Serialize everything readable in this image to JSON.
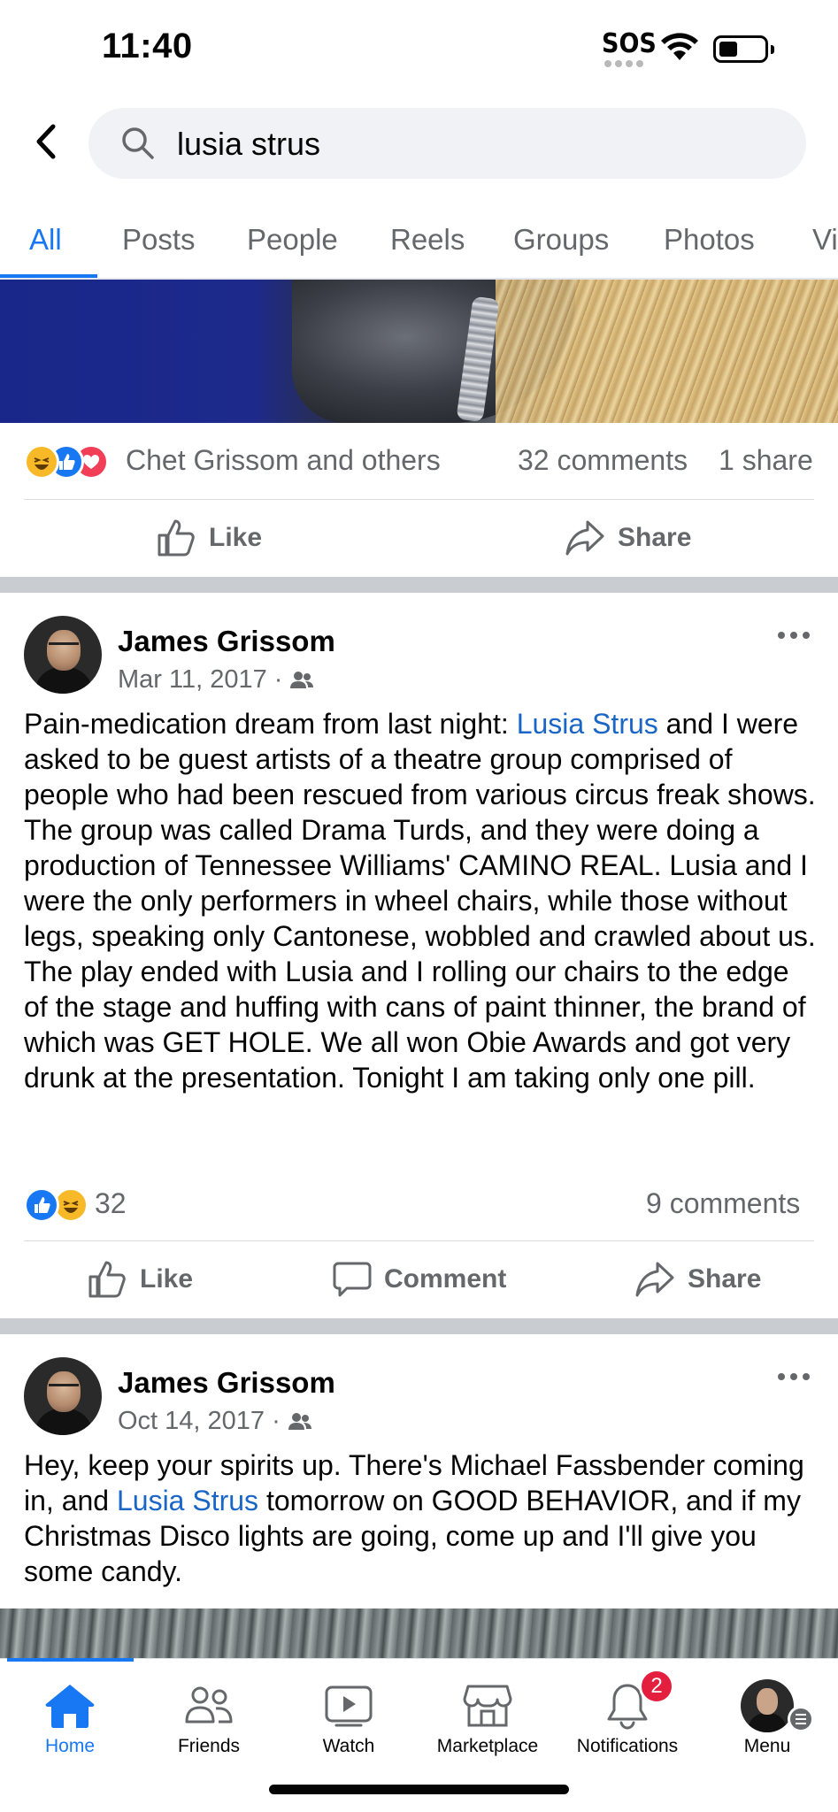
{
  "status_bar": {
    "time": "11:40",
    "sos": "SOS"
  },
  "search": {
    "query": "lusia strus"
  },
  "tabs": [
    "All",
    "Posts",
    "People",
    "Reels",
    "Groups",
    "Photos",
    "Vi"
  ],
  "previous_post": {
    "reactions_text": "Chet Grissom and others",
    "comments": "32 comments",
    "shares": "1 share",
    "actions": {
      "like": "Like",
      "share": "Share"
    }
  },
  "post1": {
    "author": "James Grissom",
    "date": "Mar 11, 2017 ·",
    "body_before": "Pain-medication dream from last night: ",
    "mention": "Lusia Strus",
    "body_after": " and I were asked to be guest artists of a theatre group comprised of people who had been rescued from various circus freak shows. The group was called Drama Turds, and they were doing a production of Tennessee Williams' CAMINO REAL. Lusia and I were the only performers in wheel chairs, while those without legs, speaking only Cantonese, wobbled and crawled about us. The play ended with Lusia and I rolling our chairs to the edge of the stage and huffing with cans of paint thinner, the brand of which was GET HOLE. We all won Obie Awards and got very drunk at the presentation. Tonight I am taking only one pill.",
    "reaction_count": "32",
    "comments": "9 comments",
    "actions": {
      "like": "Like",
      "comment": "Comment",
      "share": "Share"
    }
  },
  "post2": {
    "author": "James Grissom",
    "date": "Oct 14, 2017 ·",
    "body_before": "Hey, keep your spirits up. There's Michael Fassbender coming in, and ",
    "mention": "Lusia Strus",
    "body_after": " tomorrow on GOOD BEHAVIOR, and if my Christmas Disco lights are going, come up and I'll give you some candy."
  },
  "bottom_nav": {
    "items": [
      "Home",
      "Friends",
      "Watch",
      "Marketplace",
      "Notifications",
      "Menu"
    ],
    "notifications_badge": "2"
  },
  "colors": {
    "accent": "#1877f2",
    "mention": "#1a66c7",
    "secondary_text": "#65676b",
    "badge": "#e41e3f"
  }
}
